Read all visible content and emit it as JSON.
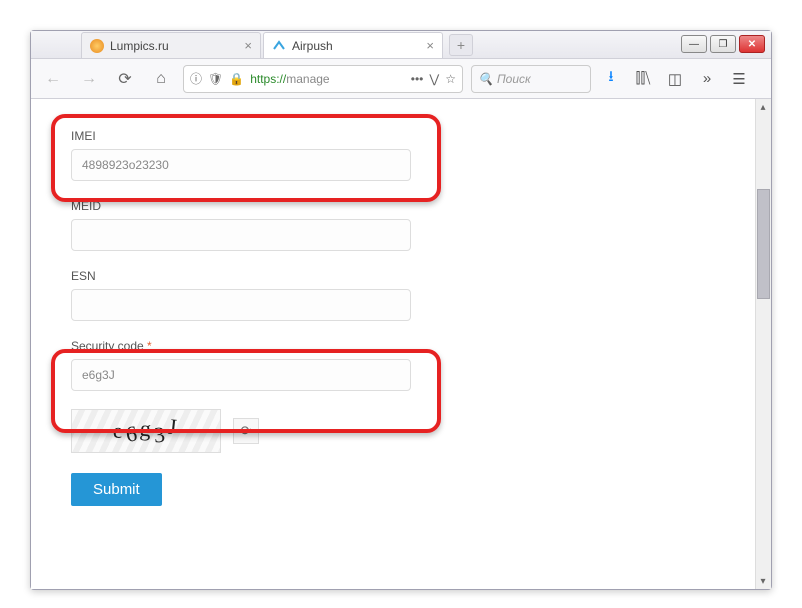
{
  "tabs": {
    "items": [
      {
        "title": "Lumpics.ru",
        "icon": "orange",
        "active": false
      },
      {
        "title": "Airpush",
        "icon": "blue",
        "active": true
      }
    ]
  },
  "urlbar": {
    "protocol": "https://",
    "rest": "manage"
  },
  "searchbar": {
    "placeholder": "Поиск"
  },
  "form": {
    "imei": {
      "label": "IMEI",
      "value": "4898923o23230"
    },
    "meid": {
      "label": "MEID",
      "value": ""
    },
    "esn": {
      "label": "ESN",
      "value": ""
    },
    "security": {
      "label": "Security code",
      "required": "*",
      "value": "e6g3J"
    },
    "captcha_text": "e6g3J",
    "submit_label": "Submit"
  },
  "window_controls": {
    "min": "—",
    "max": "❐",
    "close": "✕"
  }
}
